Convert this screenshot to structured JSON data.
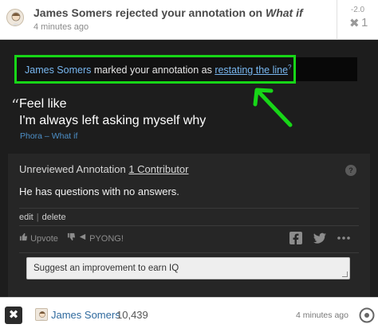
{
  "notification": {
    "title_prefix": "James Somers rejected your annotation on ",
    "title_song": "What if",
    "time": "4 minutes ago",
    "score_delta": "-2.0",
    "reject_mark": "✖",
    "reject_count": "1",
    "avatar_icon": "face-avatar-icon"
  },
  "callout": {
    "user": "James Somers",
    "middle": " marked your annotation as ",
    "status": "restating the line",
    "sup": "?"
  },
  "lyric": {
    "quote_mark": "“",
    "line1": "Feel like",
    "line2": "I'm always left asking myself why",
    "source": "Phora – What if"
  },
  "annotation": {
    "status": "Unreviewed Annotation",
    "contributors": "1 Contributor",
    "help": "?",
    "body": "He has questions with no answers.",
    "edit": "edit",
    "separator": "|",
    "delete": "delete",
    "upvote": "Upvote",
    "pyong": "PYONG!",
    "suggest_text": "Suggest an improvement to earn IQ"
  },
  "footer": {
    "close": "✖",
    "user": "James Somers",
    "iq": "10,439",
    "time": "4 minutes ago"
  },
  "colors": {
    "highlight_border": "#17d617",
    "link": "#78b7f0",
    "dark_bg": "#1d1d1d"
  }
}
